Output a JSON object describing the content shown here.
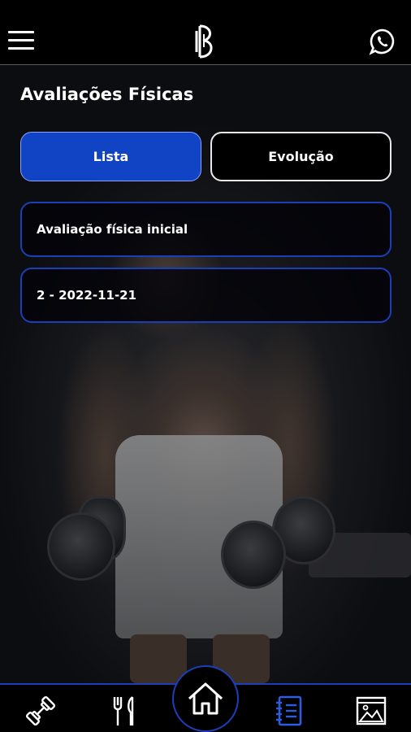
{
  "header": {
    "menu_icon": "menu-icon",
    "logo_icon": "brand-logo-icon",
    "contact_icon": "whatsapp-icon"
  },
  "page": {
    "title": "Avaliações Físicas"
  },
  "tabs": [
    {
      "label": "Lista",
      "active": true
    },
    {
      "label": "Evolução",
      "active": false
    }
  ],
  "assessments": [
    {
      "label": "Avaliação física inicial"
    },
    {
      "label": "2 - 2022-11-21"
    }
  ],
  "bottom_nav": {
    "items": [
      {
        "icon": "dumbbell-icon"
      },
      {
        "icon": "fork-knife-icon"
      },
      {
        "icon": "home-icon",
        "active": true
      },
      {
        "icon": "notebook-icon",
        "highlighted": true
      },
      {
        "icon": "gallery-icon"
      }
    ]
  },
  "colors": {
    "accent": "#1143c5",
    "card_border": "#1a3fb8",
    "background": "#000000",
    "text": "#ffffff"
  }
}
